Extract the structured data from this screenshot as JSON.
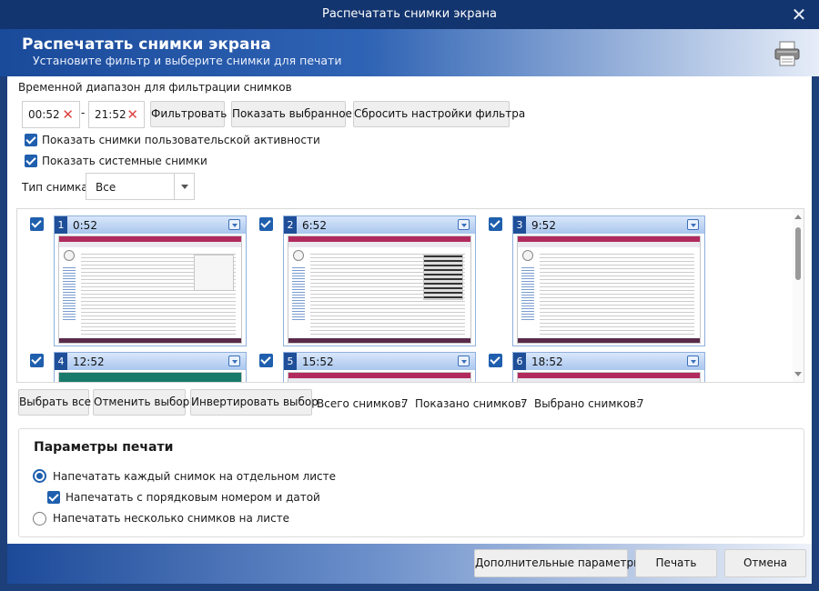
{
  "window": {
    "title": "Распечатать снимки экрана"
  },
  "header": {
    "title": "Распечатать снимки экрана",
    "subtitle": "Установите фильтр и выберите снимки для печати"
  },
  "filter": {
    "range_label": "Временной диапазон для фильтрации снимков",
    "from_time": "00:52",
    "separator": "-",
    "to_time": "21:52",
    "clear_glyph": "✕",
    "filter_button": "Фильтровать",
    "show_selected_button": "Показать выбранное",
    "reset_button": "Сбросить настройки фильтра",
    "show_user_activity": {
      "label": "Показать снимки пользовательской активности",
      "checked": true
    },
    "show_system": {
      "label": "Показать системные снимки",
      "checked": true
    },
    "type_label": "Тип снимка:",
    "type_value": "Все"
  },
  "thumbnails": [
    {
      "index": "1",
      "time": "0:52",
      "checked": true
    },
    {
      "index": "2",
      "time": "6:52",
      "checked": true
    },
    {
      "index": "3",
      "time": "9:52",
      "checked": true
    },
    {
      "index": "4",
      "time": "12:52",
      "checked": true
    },
    {
      "index": "5",
      "time": "15:52",
      "checked": true
    },
    {
      "index": "6",
      "time": "18:52",
      "checked": true
    }
  ],
  "selection": {
    "select_all": "Выбрать все",
    "deselect": "Отменить выбор",
    "invert": "Инвертировать выбор",
    "total_label": "Всего снимков:",
    "total_value": "7",
    "shown_label": "Показано снимков:",
    "shown_value": "7",
    "selected_label": "Выбрано снимков:",
    "selected_value": "7"
  },
  "print_params": {
    "title": "Параметры печати",
    "option_each": {
      "label": "Напечатать каждый снимок на отдельном листе",
      "selected": true
    },
    "option_numbered": {
      "label": "Напечатать с порядковым номером и датой",
      "checked": true
    },
    "option_multi": {
      "label": "Напечатать несколько снимков на листе",
      "selected": false
    }
  },
  "footer": {
    "advanced": "Дополнительные параметры",
    "print": "Печать",
    "cancel": "Отмена"
  },
  "colors": {
    "accent": "#1f5fae",
    "title_bar": "#13356f"
  }
}
